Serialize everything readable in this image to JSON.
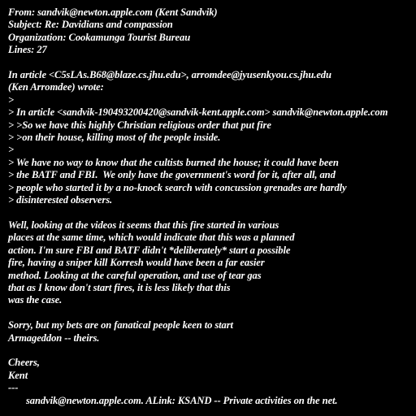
{
  "header": {
    "from": "From: sandvik@newton.apple.com (Kent Sandvik)",
    "subject": "Subject: Re: Davidians and compassion",
    "organization": "Organization: Cookamunga Tourist Bureau",
    "lines": "Lines: 27"
  },
  "attribution": [
    "In article <C5sLAs.B68@blaze.cs.jhu.edu>, arromdee@jyusenkyou.cs.jhu.edu",
    "(Ken Arromdee) wrote:"
  ],
  "quoted": [
    ">",
    "> In article <sandvik-190493200420@sandvik-kent.apple.com> sandvik@newton.apple.com",
    "> >So we have this highly Christian religious order that put fire",
    "> >on their house, killing most of the people inside.",
    ">",
    "> We have no way to know that the cultists burned the house; it could have been",
    "> the BATF and FBI.  We only have the government's word for it, after all, and",
    "> people who started it by a no-knock search with concussion grenades are hardly",
    "> disinterested observers."
  ],
  "body_paragraph_1": [
    "Well, looking at the videos it seems that this fire started in various",
    "places at the same time, which would indicate that this was a planned",
    "action. I'm sure FBI and BATF didn't *deliberately* start a possible",
    "fire, having a sniper kill Korresh would have been a far easier",
    "method. Looking at the careful operation, and use of tear gas",
    "that as I know don't start fires, it is less likely that this",
    "was the case."
  ],
  "body_paragraph_2": [
    "Sorry, but my bets are on fanatical people keen to start",
    "Armageddon -- theirs."
  ],
  "signoff": [
    "Cheers,",
    "Kent",
    "---"
  ],
  "signature_partial": "sandvik@newton.apple.com. ALink: KSAND -- Private activities on the net."
}
